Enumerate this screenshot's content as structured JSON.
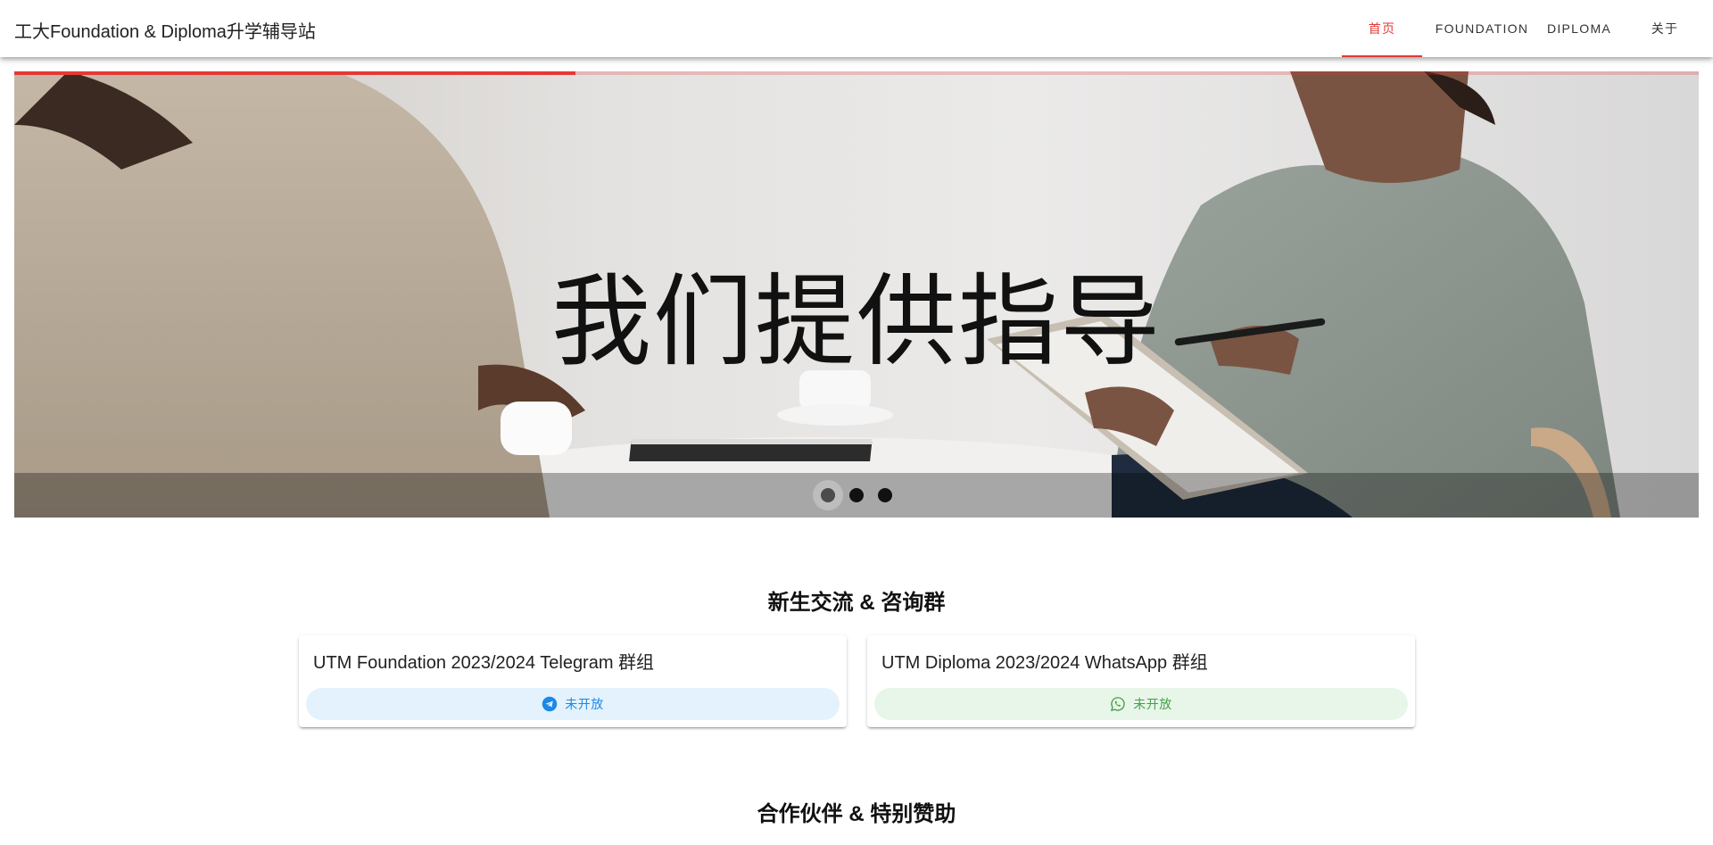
{
  "header": {
    "site_title": "工大Foundation & Diploma升学辅导站",
    "tabs": [
      {
        "label": "首页",
        "active": true
      },
      {
        "label": "FOUNDATION",
        "active": false
      },
      {
        "label": "DIPLOMA",
        "active": false
      },
      {
        "label": "关于",
        "active": false
      }
    ]
  },
  "carousel": {
    "headline": "我们提供指导",
    "progress": 0.333,
    "slide_count": 3,
    "active_slide": 0
  },
  "groups": {
    "title": "新生交流 & 咨询群",
    "cards": [
      {
        "title": "UTM Foundation 2023/2024 Telegram 群组",
        "button_label": "未开放",
        "icon": "telegram-icon"
      },
      {
        "title": "UTM Diploma 2023/2024 WhatsApp 群组",
        "button_label": "未开放",
        "icon": "whatsapp-icon"
      }
    ]
  },
  "partners": {
    "title": "合作伙伴 & 特别赞助"
  },
  "colors": {
    "accent": "#e53935",
    "telegram": "#1e88e5",
    "whatsapp": "#43a047"
  }
}
